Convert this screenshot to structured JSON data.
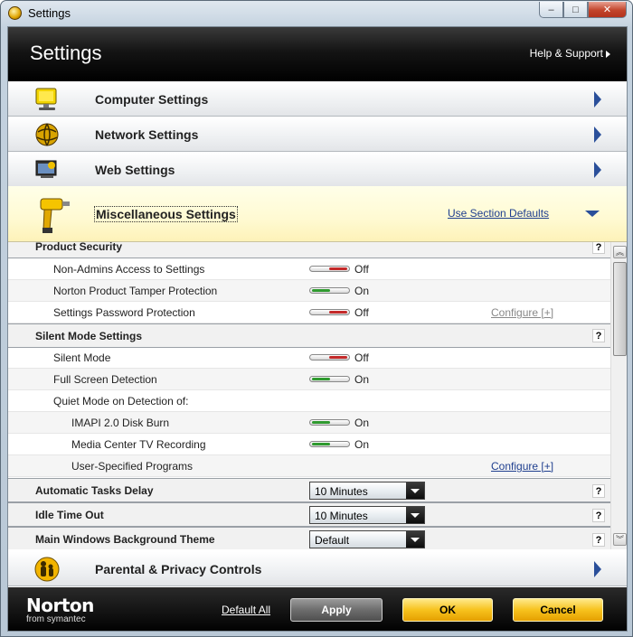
{
  "window": {
    "title": "Settings",
    "controls": [
      "–",
      "□",
      "✕"
    ]
  },
  "header": {
    "title": "Settings",
    "help_link": "Help & Support"
  },
  "sections": {
    "computer": "Computer Settings",
    "network": "Network Settings",
    "web": "Web Settings",
    "misc": "Miscellaneous Settings",
    "misc_defaults": "Use Section Defaults",
    "parental": "Parental & Privacy Controls"
  },
  "product_security": {
    "title": "Product Security",
    "help": "?",
    "items": [
      {
        "label": "Non-Admins Access to Settings",
        "state": "Off"
      },
      {
        "label": "Norton Product Tamper Protection",
        "state": "On"
      },
      {
        "label": "Settings Password Protection",
        "state": "Off",
        "configure": "Configure [+]"
      }
    ]
  },
  "silent_mode": {
    "title": "Silent Mode Settings",
    "help": "?",
    "items": [
      {
        "label": "Silent Mode",
        "state": "Off"
      },
      {
        "label": "Full Screen Detection",
        "state": "On"
      },
      {
        "label": "Quiet Mode on Detection of:"
      },
      {
        "label": "IMAPI 2.0 Disk Burn",
        "state": "On"
      },
      {
        "label": "Media Center TV Recording",
        "state": "On"
      },
      {
        "label": "User-Specified Programs",
        "configure": "Configure [+]"
      }
    ]
  },
  "dropdown_rows": [
    {
      "label": "Automatic Tasks Delay",
      "value": "10 Minutes",
      "help": "?"
    },
    {
      "label": "Idle Time Out",
      "value": "10 Minutes",
      "help": "?"
    },
    {
      "label": "Main Windows Background Theme",
      "value": "Default",
      "help": "?"
    }
  ],
  "footer": {
    "logo": "Norton",
    "logo_sub": "from symantec",
    "default_all": "Default All",
    "apply": "Apply",
    "ok": "OK",
    "cancel": "Cancel"
  }
}
